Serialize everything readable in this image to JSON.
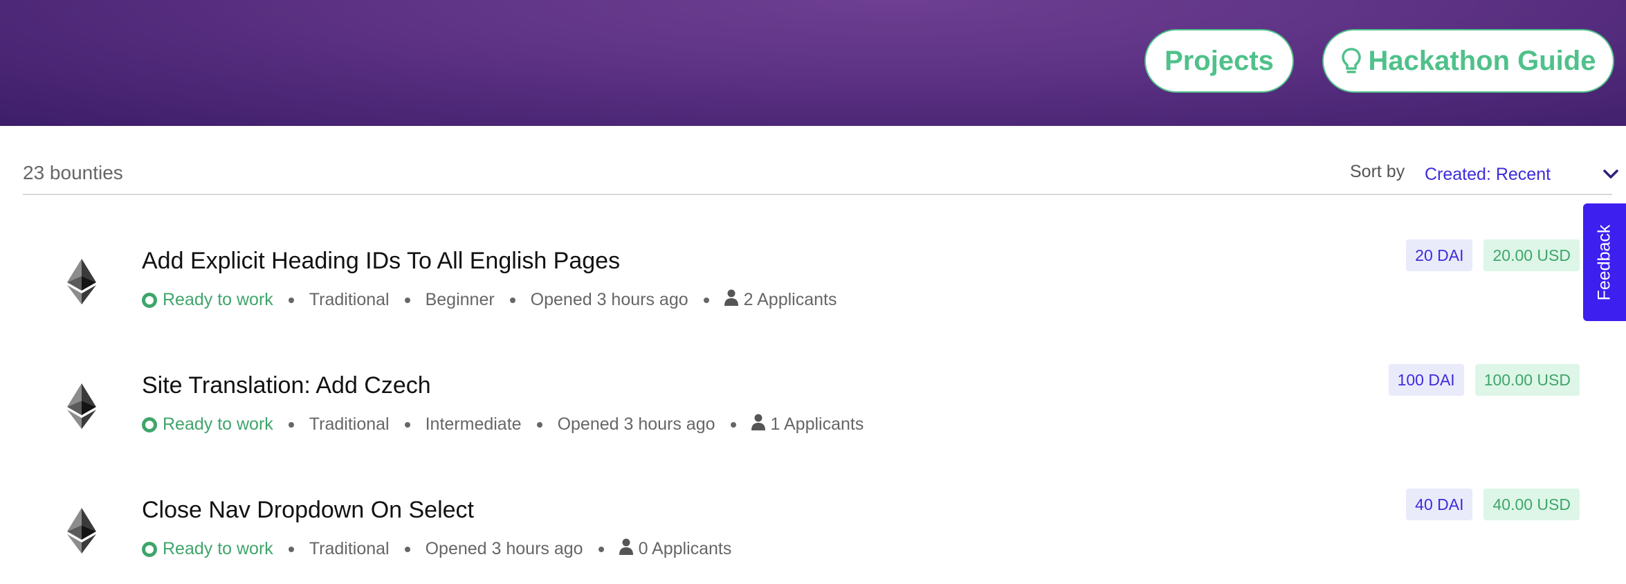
{
  "header": {
    "projects_label": "Projects",
    "guide_label": "Hackathon Guide",
    "accent_color": "#4fc18a",
    "background_color": "#5c3183"
  },
  "toolbar": {
    "count_text": "23 bounties",
    "sort_label": "Sort by",
    "sort_value": "Created: Recent"
  },
  "bounties": [
    {
      "title": "Add Explicit Heading IDs To All English Pages",
      "status": "Ready to work",
      "type": "Traditional",
      "level": "Beginner",
      "opened": "Opened 3 hours ago",
      "applicants": "2 Applicants",
      "token_amount": "20 DAI",
      "usd_amount": "20.00 USD",
      "icon": "ethereum-icon"
    },
    {
      "title": "Site Translation: Add Czech",
      "status": "Ready to work",
      "type": "Traditional",
      "level": "Intermediate",
      "opened": "Opened 3 hours ago",
      "applicants": "1 Applicants",
      "token_amount": "100 DAI",
      "usd_amount": "100.00 USD",
      "icon": "ethereum-icon"
    },
    {
      "title": "Close Nav Dropdown On Select",
      "status": "Ready to work",
      "type": "Traditional",
      "level": "",
      "opened": "Opened 3 hours ago",
      "applicants": "0 Applicants",
      "token_amount": "40 DAI",
      "usd_amount": "40.00 USD",
      "icon": "ethereum-icon"
    }
  ],
  "feedback": {
    "label": "Feedback",
    "color": "#3d1ff0"
  },
  "colors": {
    "status_green": "#3fa56b",
    "token_blue": "#3d2bdb"
  }
}
